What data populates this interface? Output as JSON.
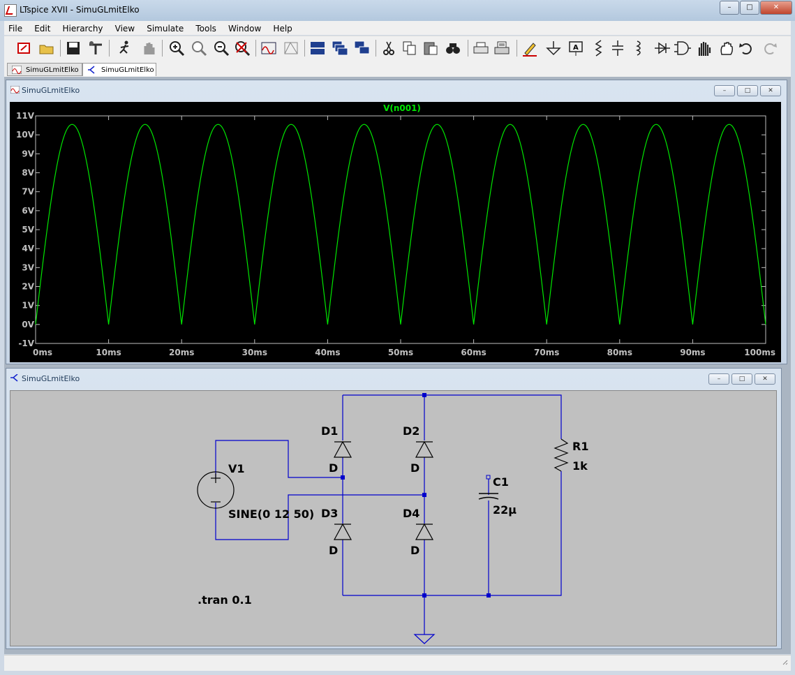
{
  "window": {
    "title": "LTspice XVII - SimuGLmitElko",
    "minimize_label": "–",
    "maximize_label": "□",
    "close_label": "✕"
  },
  "menu": [
    "File",
    "Edit",
    "Hierarchy",
    "View",
    "Simulate",
    "Tools",
    "Window",
    "Help"
  ],
  "toolbar_icons": [
    "new-schematic-icon",
    "open-icon",
    "save-icon",
    "control-panel-icon",
    "run-icon",
    "halt-icon",
    "zoom-in-icon",
    "zoom-pan-icon",
    "zoom-out-icon",
    "zoom-cancel-icon",
    "autorange-icon",
    "fit-icon",
    "tile-horizontal-icon",
    "cascade-icon",
    "tile-vertical-icon",
    "cut-icon",
    "copy-icon",
    "paste-icon",
    "find-icon",
    "print-setup-icon",
    "print-icon",
    "label-net-icon",
    "ground-icon",
    "label-icon",
    "resistor-icon",
    "capacitor-icon",
    "inductor-icon",
    "diode-icon",
    "component-icon",
    "move-icon",
    "drag-icon",
    "undo-icon",
    "redo-icon"
  ],
  "tabs": [
    {
      "label": "SimuGLmitElko",
      "icon": "waveform-tab-icon"
    },
    {
      "label": "SimuGLmitElko",
      "icon": "schematic-tab-icon"
    }
  ],
  "waveform_window": {
    "title": "SimuGLmitElko",
    "trace_label": "V(n001)",
    "trace_color": "#00e600",
    "background": "#000000"
  },
  "schematic_window": {
    "title": "SimuGLmitElko",
    "components": {
      "D1": {
        "name": "D1",
        "value": "D"
      },
      "D2": {
        "name": "D2",
        "value": "D"
      },
      "D3": {
        "name": "D3",
        "value": "D"
      },
      "D4": {
        "name": "D4",
        "value": "D"
      },
      "V1": {
        "name": "V1",
        "value": "SINE(0 12 50)"
      },
      "C1": {
        "name": "C1",
        "value": "22µ"
      },
      "R1": {
        "name": "R1",
        "value": "1k"
      }
    },
    "directive": ".tran 0.1",
    "wire_color": "#0000cc"
  },
  "status": {
    "text": ""
  },
  "chart_data": {
    "type": "line",
    "title": "V(n001)",
    "xlabel": "",
    "ylabel": "",
    "x_unit": "ms",
    "y_unit": "V",
    "xlim": [
      0,
      100
    ],
    "ylim": [
      -1,
      11
    ],
    "x_ticks": [
      "0ms",
      "10ms",
      "20ms",
      "30ms",
      "40ms",
      "50ms",
      "60ms",
      "70ms",
      "80ms",
      "90ms",
      "100ms"
    ],
    "y_ticks": [
      "11V",
      "10V",
      "9V",
      "8V",
      "7V",
      "6V",
      "5V",
      "4V",
      "3V",
      "2V",
      "1V",
      "0V",
      "-1V"
    ],
    "grid": false,
    "series": [
      {
        "name": "V(n001)",
        "description": "full-wave rectified sine, peak 10.55 V, zero at multiples of 10 ms",
        "peak": 10.55,
        "period_ms": 10,
        "x": [
          0,
          2.5,
          5,
          7.5,
          10,
          12.5,
          15,
          17.5,
          20,
          22.5,
          25,
          27.5,
          30,
          32.5,
          35,
          37.5,
          40,
          42.5,
          45,
          47.5,
          50,
          52.5,
          55,
          57.5,
          60,
          62.5,
          65,
          67.5,
          70,
          72.5,
          75,
          77.5,
          80,
          82.5,
          85,
          87.5,
          90,
          92.5,
          95,
          97.5,
          100
        ],
        "values": [
          0,
          7.46,
          10.55,
          7.46,
          0,
          7.46,
          10.55,
          7.46,
          0,
          7.46,
          10.55,
          7.46,
          0,
          7.46,
          10.55,
          7.46,
          0,
          7.46,
          10.55,
          7.46,
          0,
          7.46,
          10.55,
          7.46,
          0,
          7.46,
          10.55,
          7.46,
          0,
          7.46,
          10.55,
          7.46,
          0,
          7.46,
          10.55,
          7.46,
          0,
          7.46,
          10.55,
          7.46,
          0
        ]
      }
    ]
  }
}
